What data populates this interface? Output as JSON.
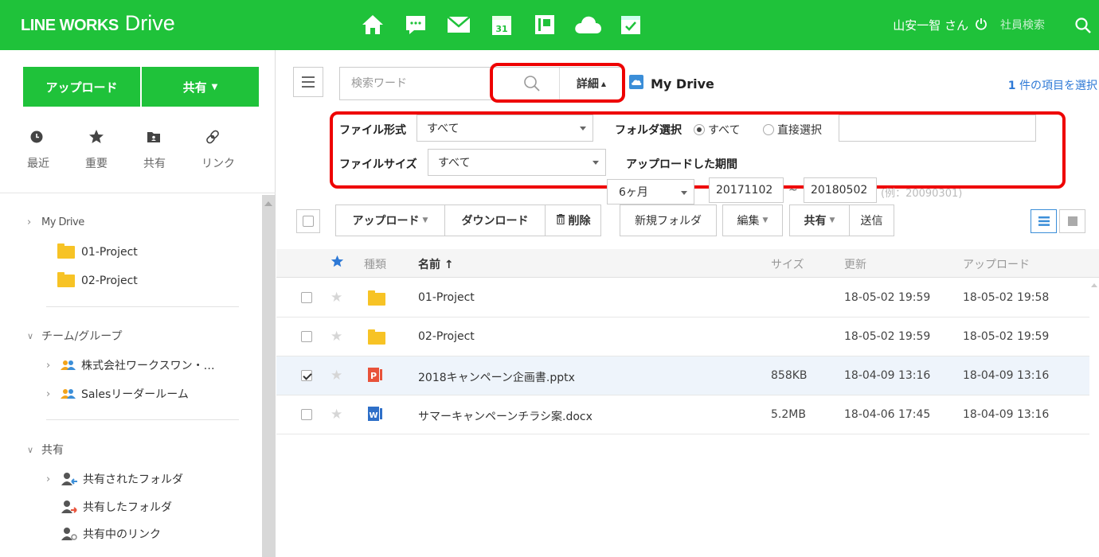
{
  "brand": {
    "logo_main": "LINE WORKS",
    "logo_sub": "Drive",
    "accent": "#1fc23a",
    "highlight": "#ee0000"
  },
  "top_nav": {
    "apps": [
      {
        "name": "home-icon"
      },
      {
        "name": "talk-icon"
      },
      {
        "name": "mail-icon"
      },
      {
        "name": "calendar-icon",
        "text": "31"
      },
      {
        "name": "contacts-icon"
      },
      {
        "name": "drive-cloud-icon"
      },
      {
        "name": "form-icon"
      }
    ],
    "user_name": "山安一智 さん",
    "employee_search_placeholder": "社員検索"
  },
  "sidebar": {
    "upload_label": "アップロード",
    "share_label": "共有",
    "quick": [
      {
        "label": "最近",
        "icon": "clock-icon"
      },
      {
        "label": "重要",
        "icon": "star-icon"
      },
      {
        "label": "共有",
        "icon": "shared-folder-icon"
      },
      {
        "label": "リンク",
        "icon": "link-icon"
      }
    ],
    "tree": {
      "my_drive": "My Drive",
      "folders": [
        "01-Project",
        "02-Project"
      ],
      "team_group": "チーム/グループ",
      "groups": [
        "株式会社ワークスワン・…",
        "Salesリーダールーム"
      ],
      "shared": "共有",
      "shared_items": [
        "共有されたフォルダ",
        "共有したフォルダ",
        "共有中のリンク"
      ]
    }
  },
  "main": {
    "search_placeholder": "検索ワード",
    "detail_label": "詳細",
    "breadcrumb": "My Drive",
    "selection_count": "1",
    "selection_text": " 件の項目を選択",
    "filters": {
      "file_type_label": "ファイル形式",
      "file_type_value": "すべて",
      "folder_select_label": "フォルダ選択",
      "folder_all": "すべて",
      "folder_direct": "直接選択",
      "file_size_label": "ファイルサイズ",
      "file_size_value": "すべて",
      "upload_period_label": "アップロードした期間",
      "period_value": "6ヶ月",
      "date_from": "20171102",
      "date_sep": "~",
      "date_to": "20180502",
      "date_hint": "(例：20090301)"
    },
    "toolbar": {
      "upload": "アップロード",
      "download": "ダウンロード",
      "delete": "削除",
      "new_folder": "新規フォルダ",
      "edit": "編集",
      "share": "共有",
      "send": "送信"
    },
    "columns": {
      "type": "種類",
      "name": "名前 ↑",
      "size": "サイズ",
      "updated": "更新",
      "uploaded": "アップロード"
    },
    "files": [
      {
        "name": "01-Project",
        "type": "folder",
        "size": "",
        "updated": "18-05-02 19:59",
        "uploaded": "18-05-02 19:58",
        "selected": false
      },
      {
        "name": "02-Project",
        "type": "folder",
        "size": "",
        "updated": "18-05-02 19:59",
        "uploaded": "18-05-02 19:59",
        "selected": false
      },
      {
        "name": "2018キャンペーン企画書.pptx",
        "type": "pptx",
        "size": "858KB",
        "updated": "18-04-09 13:16",
        "uploaded": "18-04-09 13:16",
        "selected": true
      },
      {
        "name": "サマーキャンペーンチラシ案.docx",
        "type": "docx",
        "size": "5.2MB",
        "updated": "18-04-06 17:45",
        "uploaded": "18-04-09 13:16",
        "selected": false
      }
    ]
  }
}
